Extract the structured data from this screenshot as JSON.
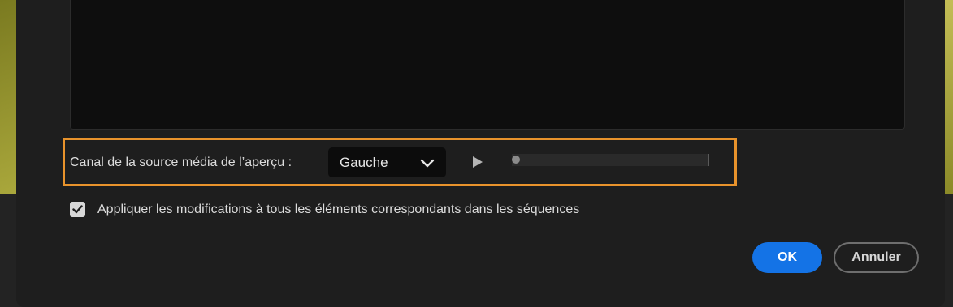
{
  "preview": {
    "channel_label": "Canal de la source média de l’aperçu :",
    "channel_dropdown": {
      "selected": "Gauche",
      "icon": "chevron-down-icon"
    },
    "play_icon": "play-icon",
    "scrubber_position": 0
  },
  "apply_all": {
    "checked": true,
    "label": "Appliquer les modifications à tous les éléments correspondants dans les séquences"
  },
  "buttons": {
    "ok_label": "OK",
    "cancel_label": "Annuler"
  },
  "colors": {
    "accent": "#1473e6",
    "highlight": "#e8932c",
    "dialog_bg": "#1e1e1e"
  }
}
